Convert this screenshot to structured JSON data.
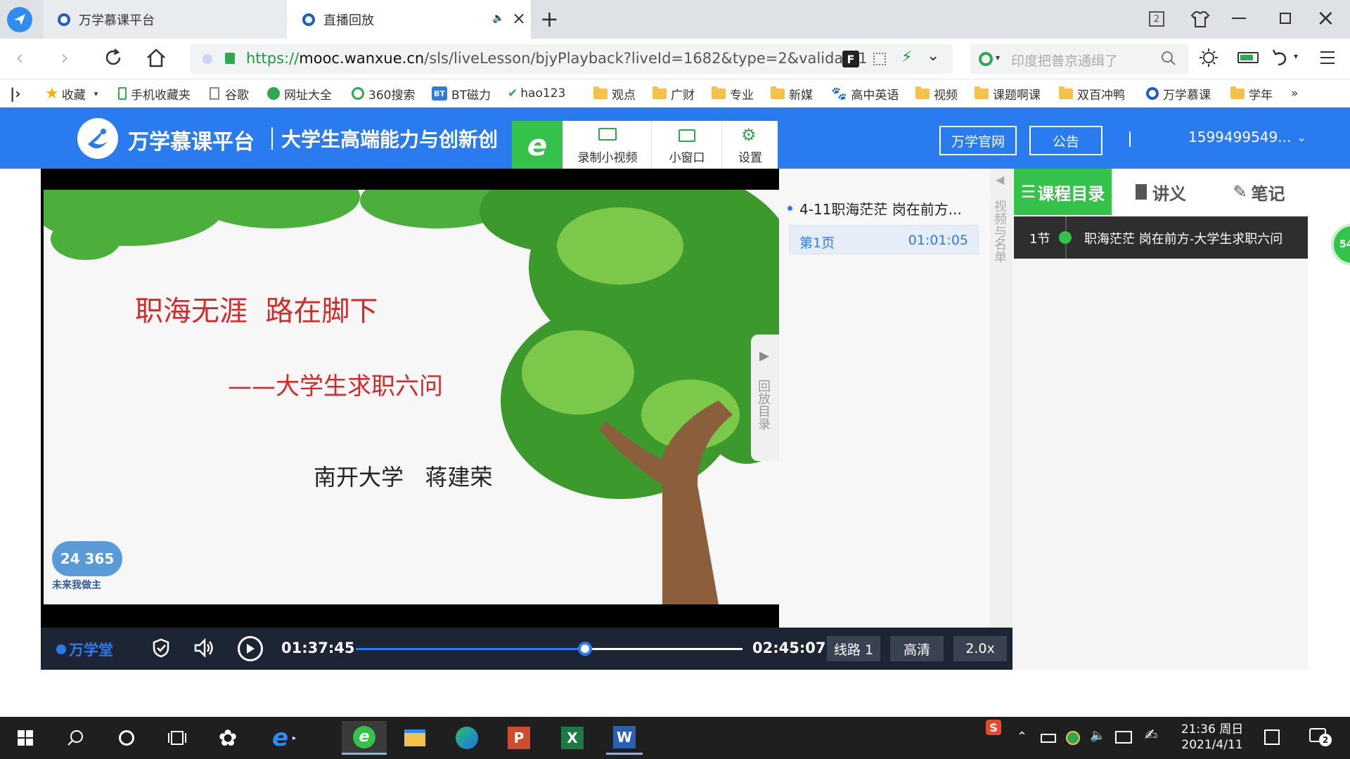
{
  "browser": {
    "tabs": [
      {
        "title": "万学慕课平台"
      },
      {
        "title": "直播回放"
      }
    ],
    "tab_count": "2",
    "url": "https://mooc.wanxue.cn/sls/liveLesson/bjyPlayback?liveId=1682&type=2&validate1",
    "url_scheme": "https://",
    "url_host": "mooc.wanxue.cn",
    "url_path": "/sls/liveLesson/bjyPlayback?liveId=1682&type=2&validate1",
    "search_placeholder": "印度把普京通缉了"
  },
  "bookmarks": [
    {
      "label": "收藏",
      "icon": "star"
    },
    {
      "label": "手机收藏夹",
      "icon": "phone"
    },
    {
      "label": "谷歌",
      "icon": "page"
    },
    {
      "label": "网址大全",
      "icon": "green"
    },
    {
      "label": "360搜索",
      "icon": "360"
    },
    {
      "label": "BT磁力",
      "icon": "bt"
    },
    {
      "label": "hao123",
      "icon": "hao"
    },
    {
      "label": "观点",
      "icon": "folder"
    },
    {
      "label": "广财",
      "icon": "folder"
    },
    {
      "label": "专业",
      "icon": "folder"
    },
    {
      "label": "新媒",
      "icon": "folder"
    },
    {
      "label": "高中英语",
      "icon": "paw"
    },
    {
      "label": "视频",
      "icon": "folder"
    },
    {
      "label": "课题啊课",
      "icon": "folder"
    },
    {
      "label": "双百冲鸭",
      "icon": "folder"
    },
    {
      "label": "万学慕课",
      "icon": "wanxue"
    },
    {
      "label": "学年",
      "icon": "folder"
    }
  ],
  "bookmarks_more": "»",
  "site": {
    "logo_text": "万学慕课平台",
    "subtitle": "大学生高端能力与创新创",
    "tools": [
      {
        "label": "录制小视频",
        "icon": "record-icon"
      },
      {
        "label": "小窗口",
        "icon": "tv-icon"
      },
      {
        "label": "设置",
        "icon": "gear-icon"
      }
    ],
    "official_site": "万学官网",
    "announcement": "公告",
    "user": "1599499549..."
  },
  "slide": {
    "title": "职海无涯  路在脚下",
    "subtitle": "——大学生求职六问",
    "author": "南开大学   蒋建荣",
    "badge_top": "24 365",
    "badge_bottom": "未来我做主"
  },
  "player": {
    "brand": "万学堂",
    "current_time": "01:37:45",
    "total_time": "02:45:07",
    "progress": 0.592,
    "line": "线路 1",
    "quality": "高清",
    "speed": "2.0x"
  },
  "playlist": {
    "title": "4-11职海茫茫 岗在前方...",
    "page": "第1页",
    "page_time": "01:01:05",
    "side_label": "视频与名单",
    "playback_toggle": "回放目录"
  },
  "catalog": {
    "tabs": [
      "课程目录",
      "讲义",
      "笔记"
    ],
    "items": [
      {
        "section": "1节",
        "title": "职海茫茫 岗在前方-大学生求职六问"
      }
    ]
  },
  "floating_badge": "54",
  "taskbar": {
    "time": "21:36 周日",
    "date": "2021/4/11",
    "notifications": "2"
  }
}
